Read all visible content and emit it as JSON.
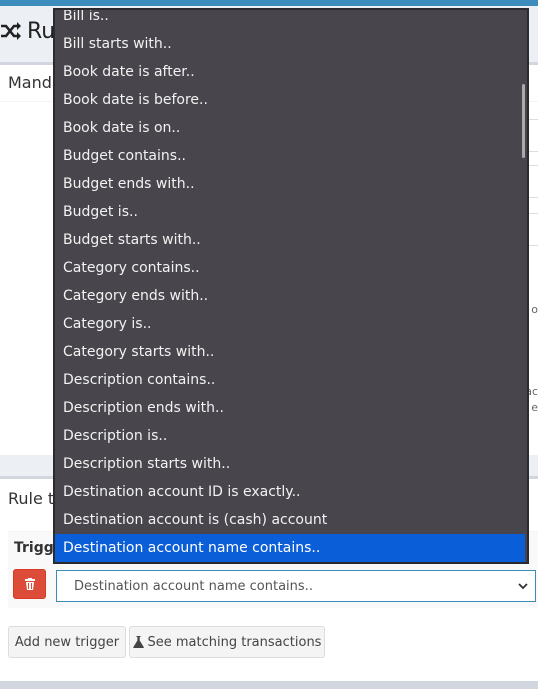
{
  "header": {
    "title": "Ru"
  },
  "mandatory_box": {
    "title": "Manda",
    "edge_chars": [
      "o",
      "ac",
      "e"
    ]
  },
  "rule_triggers_box": {
    "title": "Rule t",
    "table_header": "Trigge",
    "selected_value": "Destination account name contains.."
  },
  "buttons": {
    "add_trigger": "Add new trigger",
    "see_matching": "See matching transactions"
  },
  "dropdown": {
    "options": [
      "Bill is..",
      "Bill starts with..",
      "Book date is after..",
      "Book date is before..",
      "Book date is on..",
      "Budget contains..",
      "Budget ends with..",
      "Budget is..",
      "Budget starts with..",
      "Category contains..",
      "Category ends with..",
      "Category is..",
      "Category starts with..",
      "Description contains..",
      "Description ends with..",
      "Description is..",
      "Description starts with..",
      "Destination account ID is exactly..",
      "Destination account is (cash) account",
      "Destination account name contains.."
    ],
    "selected_index": 19
  },
  "colors": {
    "accent": "#3c8dbc",
    "danger": "#dd4b39",
    "selected": "#0a5ed7",
    "dropdown_bg": "#48464c"
  }
}
